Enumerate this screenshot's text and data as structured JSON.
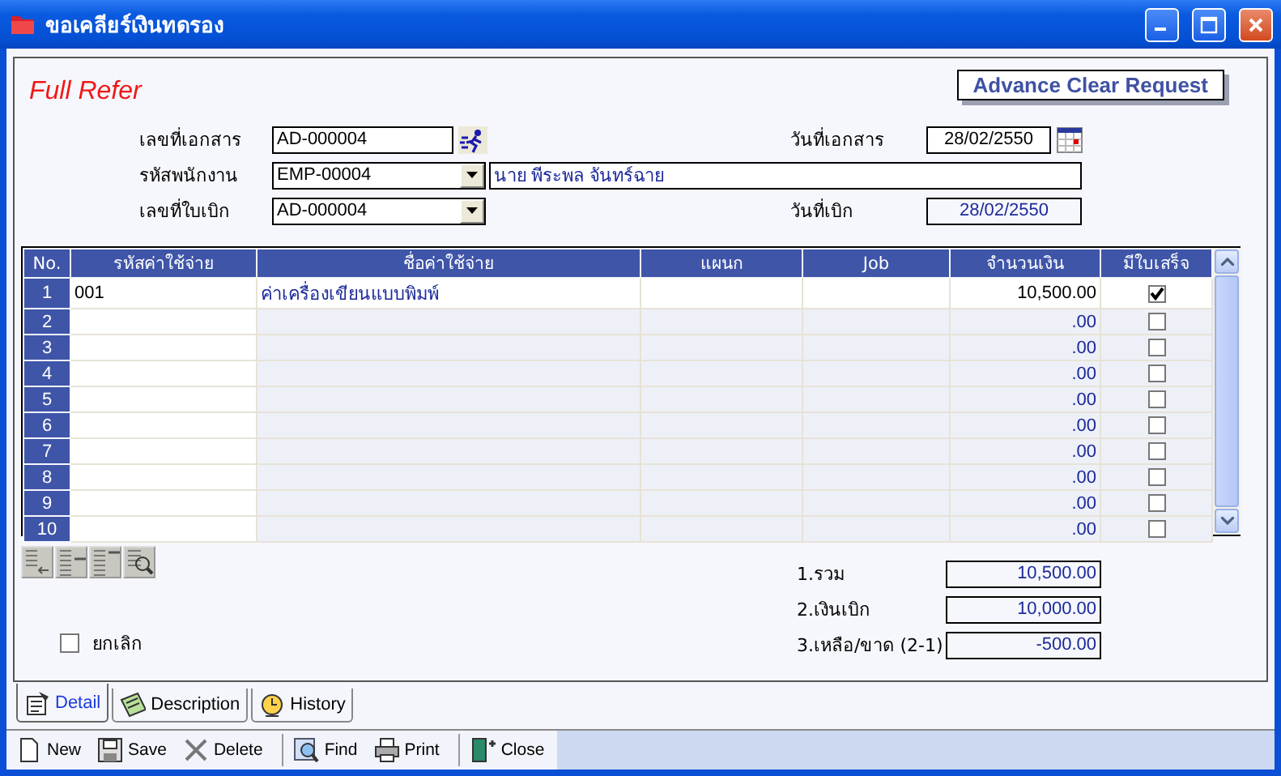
{
  "window": {
    "title": "ขอเคลียร์เงินทดรอง"
  },
  "form_title": "Full Refer",
  "form_badge": "Advance Clear Request",
  "document_no": {
    "label": "เลขที่เอกสาร",
    "value": "AD-000004"
  },
  "document_date": {
    "label": "วันที่เอกสาร",
    "value": "28/02/2550"
  },
  "employee": {
    "label": "รหัสพนักงาน",
    "value": "EMP-00004",
    "name": "นาย พีระพล จันทร์ฉาย"
  },
  "requisition_no": {
    "label": "เลขที่ใบเบิก",
    "value": "AD-000004"
  },
  "requisition_date": {
    "label": "วันที่เบิก",
    "value": "28/02/2550"
  },
  "table": {
    "columns": [
      "No.",
      "รหัสค่าใช้จ่าย",
      "ชื่อค่าใช้จ่าย",
      "แผนก",
      "Job",
      "จำนวนเงิน",
      "มีใบเสร็จ"
    ],
    "rows": [
      {
        "no": "1",
        "code": "001",
        "name": "ค่าเครื่องเขียนแบบพิมพ์",
        "amount": "10,500.00",
        "receipt": true
      },
      {
        "no": "2",
        "amount": ".00",
        "receipt": false
      },
      {
        "no": "3",
        "amount": ".00",
        "receipt": false
      },
      {
        "no": "4",
        "amount": ".00",
        "receipt": false
      },
      {
        "no": "5",
        "amount": ".00",
        "receipt": false
      },
      {
        "no": "6",
        "amount": ".00",
        "receipt": false
      },
      {
        "no": "7",
        "amount": ".00",
        "receipt": false
      },
      {
        "no": "8",
        "amount": ".00",
        "receipt": false
      },
      {
        "no": "9",
        "amount": ".00",
        "receipt": false
      },
      {
        "no": "10",
        "amount": ".00",
        "receipt": false
      }
    ]
  },
  "totals": [
    {
      "label": "1.รวม",
      "value": "10,500.00"
    },
    {
      "label": "2.เงินเบิก",
      "value": "10,000.00"
    },
    {
      "label": "3.เหลือ/ขาด (2-1)",
      "value": "-500.00"
    }
  ],
  "cancel": {
    "label": "ยกเลิก",
    "checked": false
  },
  "tabs": [
    {
      "label": "Detail",
      "kind": "detail",
      "selected": true
    },
    {
      "label": "Description",
      "kind": "description",
      "selected": false
    },
    {
      "label": "History",
      "kind": "history",
      "selected": false
    }
  ],
  "toolbar": [
    {
      "label": "New",
      "kind": "new"
    },
    {
      "label": "Save",
      "kind": "save"
    },
    {
      "label": "Delete",
      "kind": "delete"
    },
    {
      "label": "Find",
      "kind": "find"
    },
    {
      "label": "Print",
      "kind": "print"
    },
    {
      "label": "Close",
      "kind": "close"
    }
  ]
}
